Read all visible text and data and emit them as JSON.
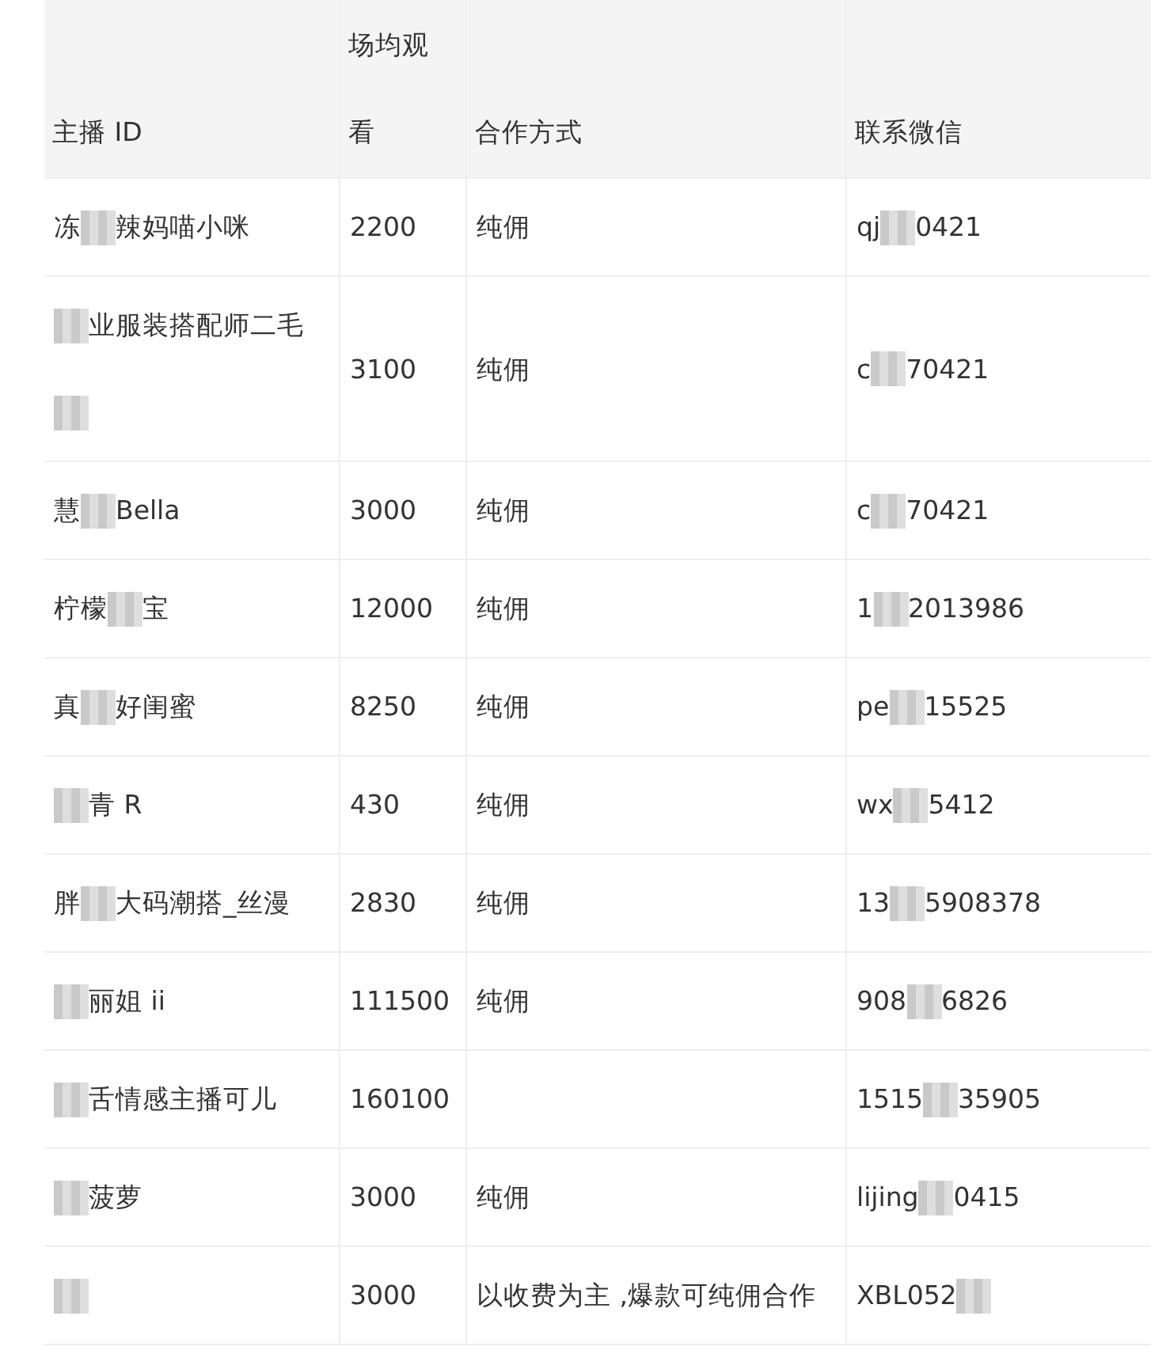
{
  "table": {
    "columns": [
      "主播 ID",
      "场均观看",
      "合作方式",
      "联系微信"
    ],
    "rows": [
      [
        [
          {
            "kind": "text",
            "text": "冻"
          },
          {
            "kind": "mosaic"
          },
          {
            "kind": "text",
            "text": "辣妈喵小咪"
          }
        ],
        [
          {
            "kind": "text",
            "text": "2200"
          }
        ],
        [
          {
            "kind": "text",
            "text": "纯佣"
          }
        ],
        [
          {
            "kind": "text",
            "text": "qj"
          },
          {
            "kind": "mosaic"
          },
          {
            "kind": "text",
            "text": "0421"
          }
        ]
      ],
      [
        [
          {
            "kind": "mosaic"
          },
          {
            "kind": "text",
            "text": "业服装搭配师二毛"
          },
          {
            "kind": "mosaic"
          }
        ],
        [
          {
            "kind": "text",
            "text": "3100"
          }
        ],
        [
          {
            "kind": "text",
            "text": "纯佣"
          }
        ],
        [
          {
            "kind": "text",
            "text": "c"
          },
          {
            "kind": "mosaic"
          },
          {
            "kind": "text",
            "text": "70421"
          }
        ]
      ],
      [
        [
          {
            "kind": "text",
            "text": "慧"
          },
          {
            "kind": "mosaic"
          },
          {
            "kind": "text",
            "text": "Bella"
          }
        ],
        [
          {
            "kind": "text",
            "text": "3000"
          }
        ],
        [
          {
            "kind": "text",
            "text": "纯佣"
          }
        ],
        [
          {
            "kind": "text",
            "text": "c"
          },
          {
            "kind": "mosaic"
          },
          {
            "kind": "text",
            "text": "70421"
          }
        ]
      ],
      [
        [
          {
            "kind": "text",
            "text": "柠檬"
          },
          {
            "kind": "mosaic"
          },
          {
            "kind": "text",
            "text": "宝"
          }
        ],
        [
          {
            "kind": "text",
            "text": "12000"
          }
        ],
        [
          {
            "kind": "text",
            "text": "纯佣"
          }
        ],
        [
          {
            "kind": "text",
            "text": "1"
          },
          {
            "kind": "mosaic"
          },
          {
            "kind": "text",
            "text": "2013986"
          }
        ]
      ],
      [
        [
          {
            "kind": "text",
            "text": "真"
          },
          {
            "kind": "mosaic"
          },
          {
            "kind": "text",
            "text": "好闺蜜"
          }
        ],
        [
          {
            "kind": "text",
            "text": "8250"
          }
        ],
        [
          {
            "kind": "text",
            "text": "纯佣"
          }
        ],
        [
          {
            "kind": "text",
            "text": "pe"
          },
          {
            "kind": "mosaic"
          },
          {
            "kind": "text",
            "text": "15525"
          }
        ]
      ],
      [
        [
          {
            "kind": "mosaic"
          },
          {
            "kind": "text",
            "text": "青 R"
          }
        ],
        [
          {
            "kind": "text",
            "text": "430"
          }
        ],
        [
          {
            "kind": "text",
            "text": "纯佣"
          }
        ],
        [
          {
            "kind": "text",
            "text": "wx"
          },
          {
            "kind": "mosaic"
          },
          {
            "kind": "text",
            "text": "5412"
          }
        ]
      ],
      [
        [
          {
            "kind": "text",
            "text": "胖"
          },
          {
            "kind": "mosaic"
          },
          {
            "kind": "text",
            "text": "大码潮搭_丝漫"
          }
        ],
        [
          {
            "kind": "text",
            "text": "2830"
          }
        ],
        [
          {
            "kind": "text",
            "text": "纯佣"
          }
        ],
        [
          {
            "kind": "text",
            "text": "13"
          },
          {
            "kind": "mosaic"
          },
          {
            "kind": "text",
            "text": "5908378"
          }
        ]
      ],
      [
        [
          {
            "kind": "mosaic"
          },
          {
            "kind": "text",
            "text": "丽姐 ii"
          }
        ],
        [
          {
            "kind": "text",
            "text": "111500"
          }
        ],
        [
          {
            "kind": "text",
            "text": "纯佣"
          }
        ],
        [
          {
            "kind": "text",
            "text": "908"
          },
          {
            "kind": "mosaic"
          },
          {
            "kind": "text",
            "text": "6826"
          }
        ]
      ],
      [
        [
          {
            "kind": "mosaic"
          },
          {
            "kind": "text",
            "text": "舌情感主播可儿"
          }
        ],
        [
          {
            "kind": "text",
            "text": "160100"
          }
        ],
        [],
        [
          {
            "kind": "text",
            "text": "1515"
          },
          {
            "kind": "mosaic"
          },
          {
            "kind": "text",
            "text": "35905"
          }
        ]
      ],
      [
        [
          {
            "kind": "mosaic"
          },
          {
            "kind": "text",
            "text": "菠萝"
          }
        ],
        [
          {
            "kind": "text",
            "text": "3000"
          }
        ],
        [
          {
            "kind": "text",
            "text": "纯佣"
          }
        ],
        [
          {
            "kind": "text",
            "text": "lijing"
          },
          {
            "kind": "mosaic"
          },
          {
            "kind": "text",
            "text": "0415"
          }
        ]
      ],
      [
        [
          {
            "kind": "mosaic"
          }
        ],
        [
          {
            "kind": "text",
            "text": "3000"
          }
        ],
        [
          {
            "kind": "text",
            "text": "以收费为主 ,爆款可纯佣合作"
          }
        ],
        [
          {
            "kind": "text",
            "text": "XBL052"
          },
          {
            "kind": "mosaic"
          }
        ]
      ]
    ]
  }
}
